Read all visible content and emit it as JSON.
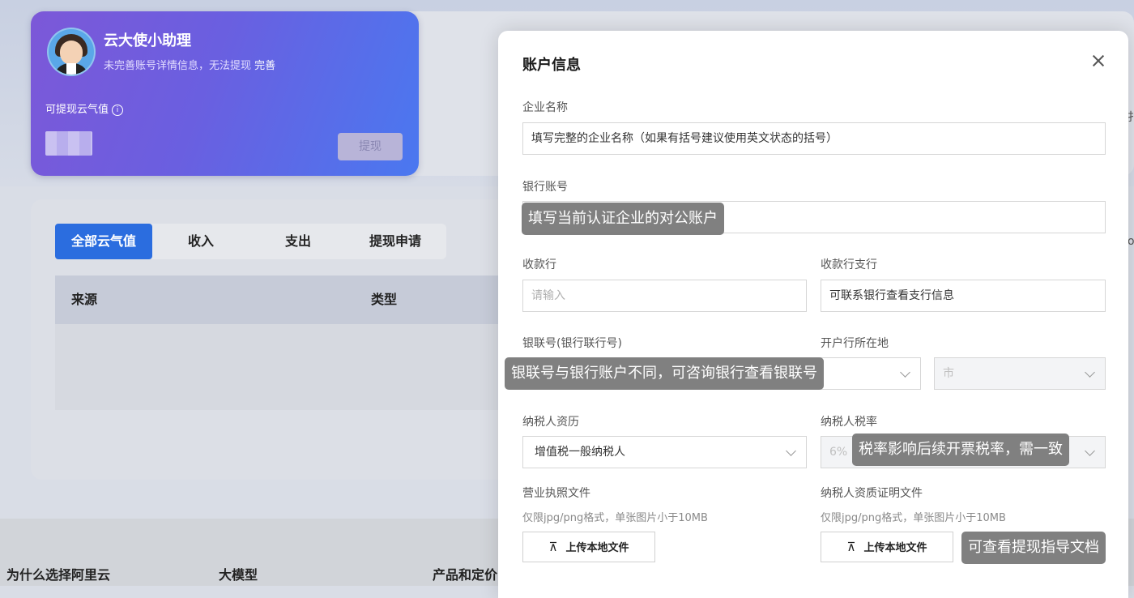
{
  "profile": {
    "name": "云大使小助理",
    "notice": "未完善账号详情信息，无法提现",
    "notice_link": "完善",
    "balance_label": "可提现云气值",
    "info_icon": "i",
    "withdraw_button": "提现"
  },
  "tabs": [
    {
      "label": "全部云气值",
      "active": true
    },
    {
      "label": "收入"
    },
    {
      "label": "支出"
    },
    {
      "label": "提现申请"
    }
  ],
  "table": {
    "columns": [
      "来源",
      "类型"
    ]
  },
  "footer": [
    "为什么选择阿里云",
    "大模型",
    "产品和定价"
  ],
  "edge_chars": [
    "扌",
    "o"
  ],
  "dialog": {
    "title": "账户信息",
    "company": {
      "label": "企业名称",
      "value": "填写完整的企业名称（如果有括号建议使用英文状态的括号）"
    },
    "bank_account": {
      "label": "银行账号",
      "value": ""
    },
    "bank": {
      "label": "收款行",
      "placeholder": "请输入"
    },
    "branch": {
      "label": "收款行支行",
      "value": "可联系银行查看支行信息"
    },
    "union_no": {
      "label": "银联号(银行联行号)"
    },
    "location": {
      "label": "开户行所在地",
      "city_placeholder": "市"
    },
    "taxpayer_type": {
      "label": "纳税人资历",
      "value": "增值税一般纳税人"
    },
    "tax_rate": {
      "label": "纳税人税率",
      "value": "6%"
    },
    "license": {
      "label": "营业执照文件",
      "hint": "仅限jpg/png格式，单张图片小于10MB",
      "button": "上传本地文件"
    },
    "qualification": {
      "label": "纳税人资质证明文件",
      "hint": "仅限jpg/png格式，单张图片小于10MB",
      "button": "上传本地文件"
    }
  },
  "tooltips": {
    "bank_account": "填写当前认证企业的对公账户",
    "union_no": "银联号与银行账户不同，可咨询银行查看银联号",
    "tax_rate": "税率影响后续开票税率，需一致",
    "guide": "可查看提现指导文档"
  }
}
